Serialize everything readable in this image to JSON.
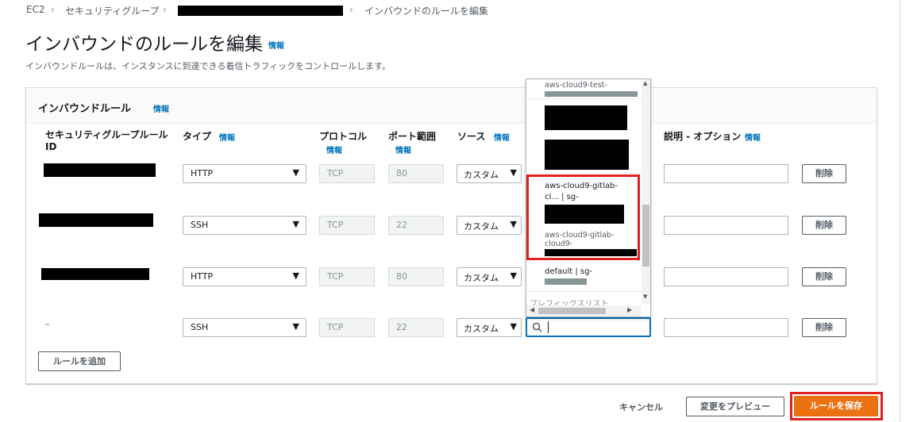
{
  "breadcrumb": {
    "ec2": "EC2",
    "sg": "セキュリティグループ",
    "current": "インバウンドのルールを編集"
  },
  "page": {
    "title": "インバウンドのルールを編集",
    "info": "情報",
    "description": "インバウンドルールは、インスタンスに到達できる着信トラフィックをコントロールします。"
  },
  "panel": {
    "title": "インバウンドルール",
    "info": "情報"
  },
  "columns": {
    "rule_id": "セキュリティグループルール ID",
    "type": "タイプ",
    "type_info": "情報",
    "protocol": "プロトコル",
    "protocol_info": "情報",
    "port": "ポート範囲",
    "port_info": "情報",
    "source": "ソース",
    "source_info": "情報",
    "desc": "説明 - オプション",
    "desc_info": "情報"
  },
  "rows": [
    {
      "rule_id": "",
      "type": "HTTP",
      "protocol": "TCP",
      "port": "80",
      "source": "カスタム",
      "delete": "削除"
    },
    {
      "rule_id": "",
      "type": "SSH",
      "protocol": "TCP",
      "port": "22",
      "source": "カスタム",
      "delete": "削除"
    },
    {
      "rule_id": "",
      "type": "HTTP",
      "protocol": "TCP",
      "port": "80",
      "source": "カスタム",
      "delete": "削除"
    },
    {
      "rule_id": "–",
      "type": "SSH",
      "protocol": "TCP",
      "port": "22",
      "source": "カスタム",
      "delete": "削除"
    }
  ],
  "dropdown": {
    "item1": "aws-cloud9-test-",
    "item_highlight_1": "aws-cloud9-gitlab-",
    "item_highlight_2": "cl... | sg-",
    "item_highlight_3": "aws-cloud9-gitlab-",
    "item_highlight_4": "cloud9-",
    "item_default": "default | sg-",
    "item_prefix": "プレフィックスリスト"
  },
  "buttons": {
    "add_rule": "ルールを追加",
    "cancel": "キャンセル",
    "preview": "変更をプレビュー",
    "save": "ルールを保存"
  },
  "icons": {
    "search": "search-icon",
    "chevron": "chevron-right-icon",
    "caret": "caret-down-icon"
  },
  "colors": {
    "accent": "#ec7211",
    "highlight": "#e0201f",
    "link": "#0073bb"
  }
}
